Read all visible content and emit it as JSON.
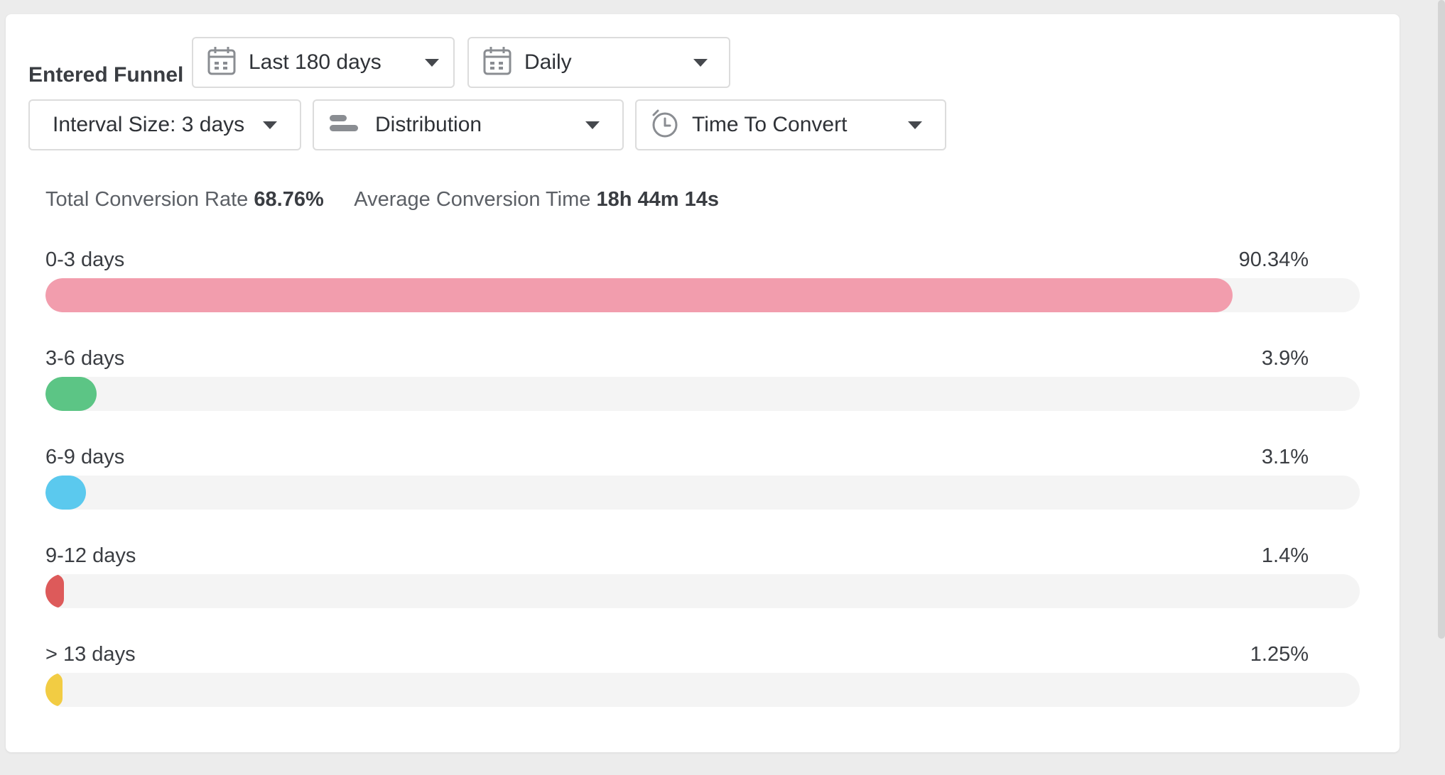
{
  "header": {
    "entered_funnel_label": "Entered Funnel",
    "date_range": {
      "value": "Last 180 days",
      "icon": "calendar-icon"
    },
    "granularity": {
      "value": "Daily",
      "icon": "calendar-icon"
    }
  },
  "controls": {
    "interval_size": "Interval Size: 3 days",
    "view_type": {
      "value": "Distribution",
      "icon": "bar-distribution-icon"
    },
    "metric": {
      "value": "Time To Convert",
      "icon": "stopwatch-icon"
    }
  },
  "stats": {
    "total_conversion_rate_label": "Total Conversion Rate",
    "total_conversion_rate_value": "68.76%",
    "avg_conversion_time_label": "Average Conversion Time",
    "avg_conversion_time_value": "18h 44m 14s"
  },
  "buckets": [
    {
      "label": "0-3 days",
      "pct_text": "90.34%",
      "pct": 90.34,
      "color": "#f29dad"
    },
    {
      "label": "3-6 days",
      "pct_text": "3.9%",
      "pct": 3.9,
      "color": "#5cc585"
    },
    {
      "label": "6-9 days",
      "pct_text": "3.1%",
      "pct": 3.1,
      "color": "#5bc9ee"
    },
    {
      "label": "9-12 days",
      "pct_text": "1.4%",
      "pct": 1.4,
      "color": "#dd5a5a"
    },
    {
      "label": "> 13 days",
      "pct_text": "1.25%",
      "pct": 1.25,
      "color": "#f2cc43"
    }
  ]
}
